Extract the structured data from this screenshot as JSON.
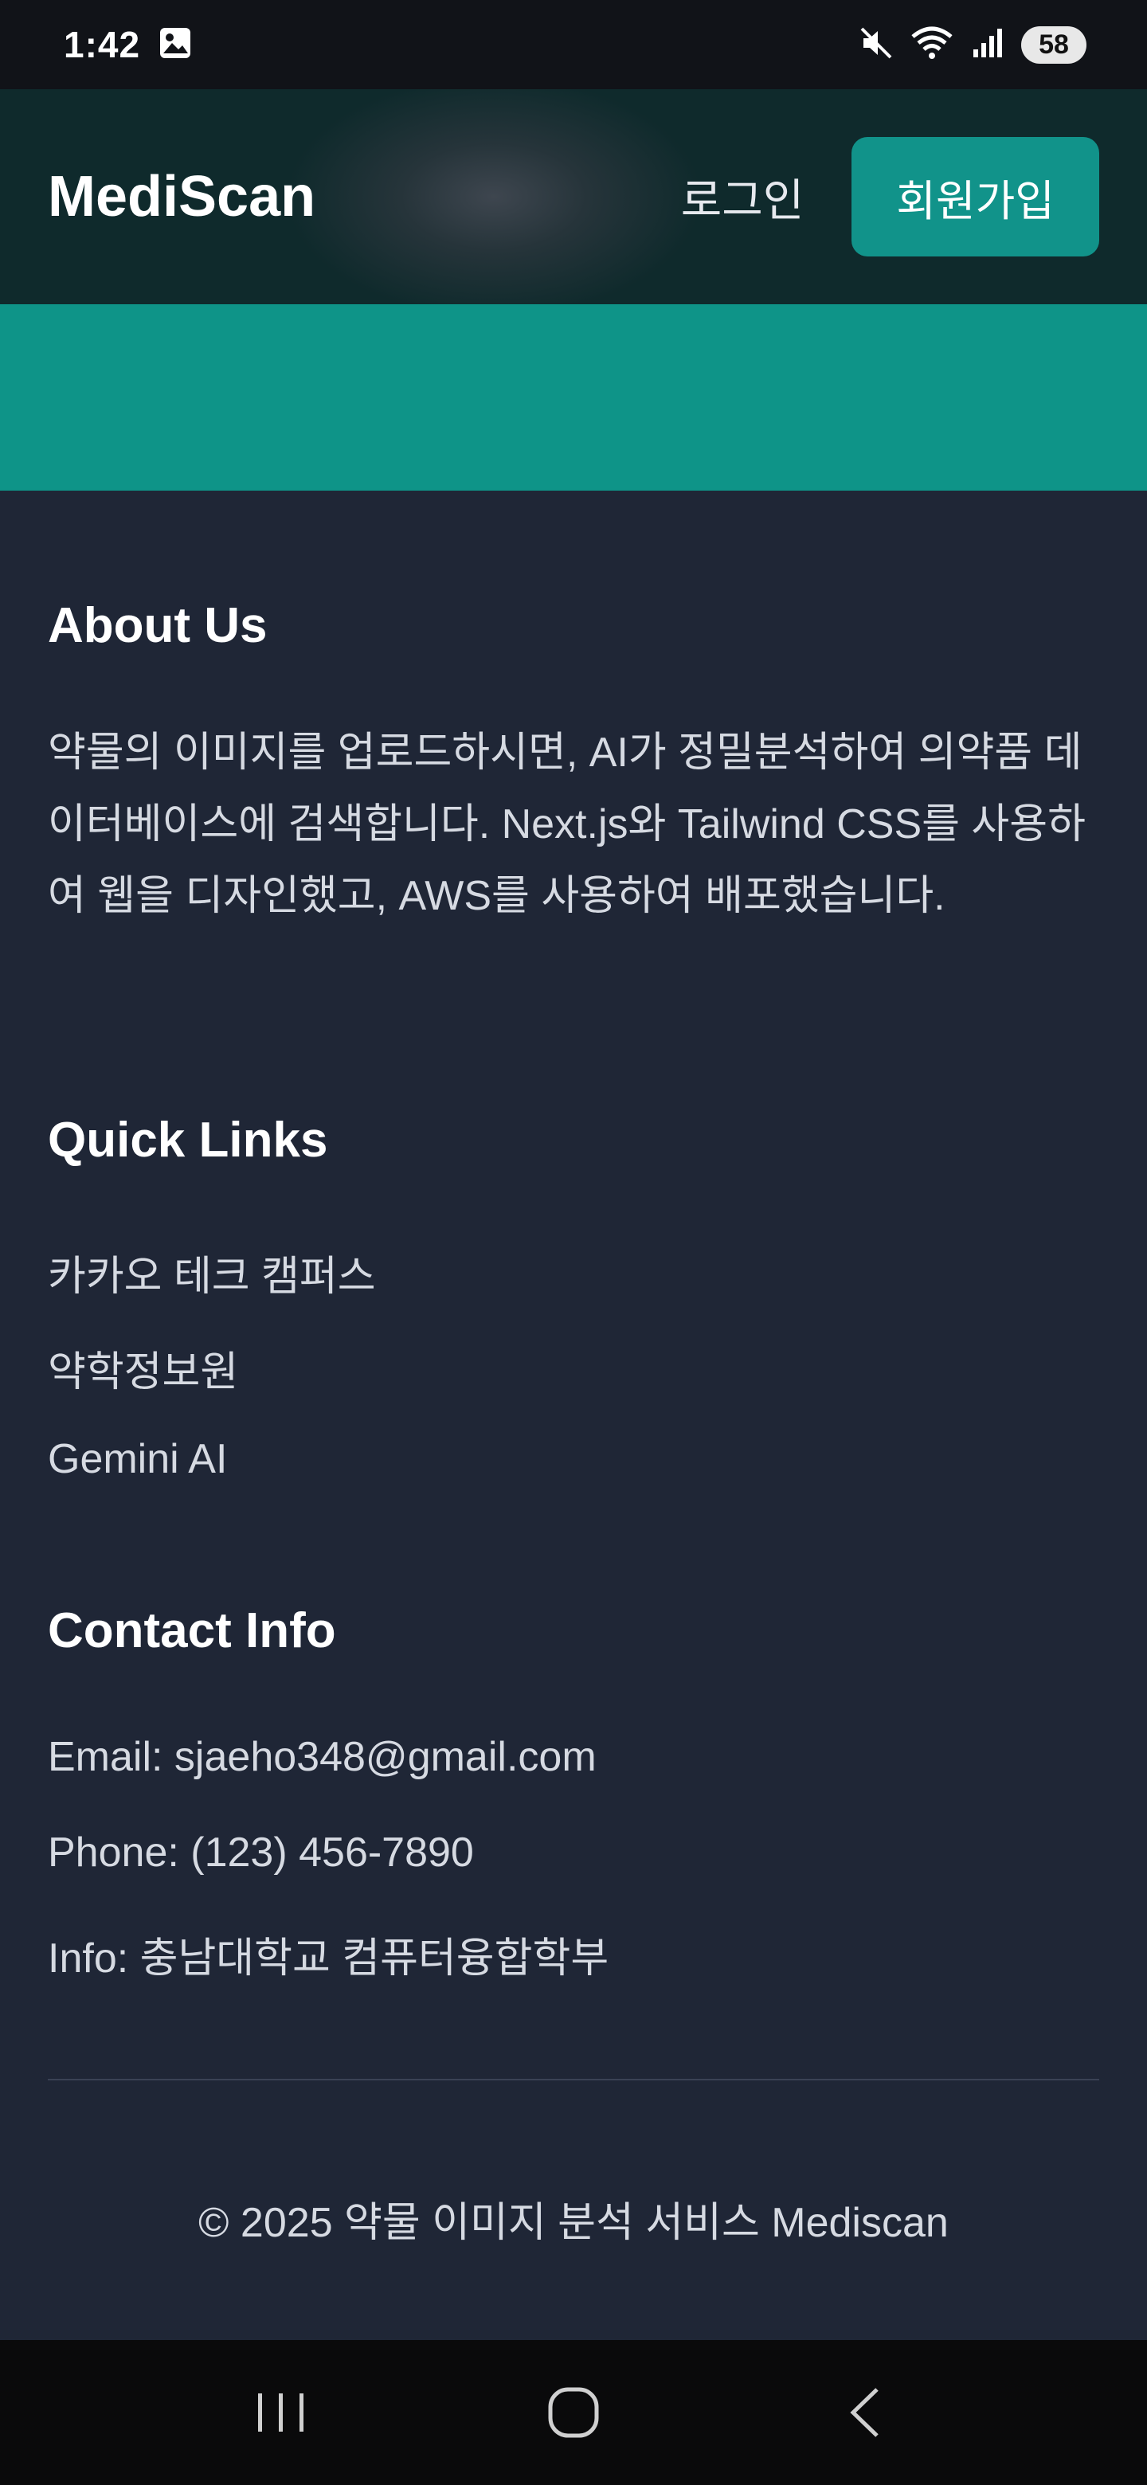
{
  "status_bar": {
    "time": "1:42",
    "battery": "58",
    "icons": [
      "image-icon",
      "mute-icon",
      "wifi-icon",
      "signal-icon"
    ]
  },
  "header": {
    "brand": "MediScan",
    "login_label": "로그인",
    "signup_label": "회원가입",
    "accent_color": "#11938a"
  },
  "footer": {
    "about": {
      "title": "About Us",
      "text": "약물의 이미지를 업로드하시면, AI가 정밀분석하여 의약품 데이터베이스에 검색합니다. Next.js와 Tailwind CSS를 사용하여 웹을 디자인했고, AWS를 사용하여 배포했습니다."
    },
    "quick_links": {
      "title": "Quick Links",
      "items": [
        "카카오 테크 캠퍼스",
        "약학정보원",
        "Gemini AI"
      ]
    },
    "contact": {
      "title": "Contact Info",
      "email": "Email: sjaeho348@gmail.com",
      "phone": "Phone: (123) 456-7890",
      "info": "Info: 충남대학교 컴퓨터융합학부"
    },
    "copyright": "© 2025 약물 이미지 분석 서비스 Mediscan"
  },
  "nav_bar": {
    "buttons": [
      "recent-apps-icon",
      "home-icon",
      "back-icon"
    ]
  }
}
